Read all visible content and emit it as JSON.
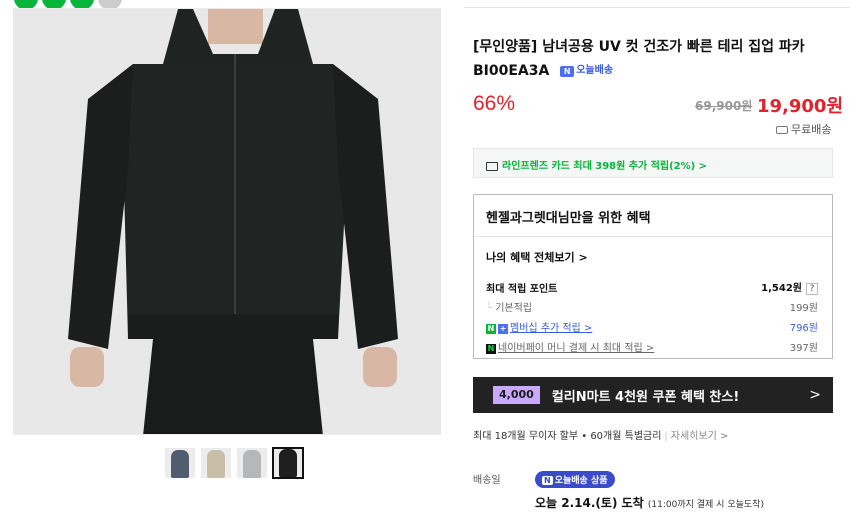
{
  "colors": {
    "accent_red": "#e0232e",
    "naver_green": "#07b53b",
    "today_blue": "#3b4cca",
    "banner_bg": "#222222",
    "coupon_purple": "#c9a8ff"
  },
  "product": {
    "title": "[무인양품] 남녀공용 UV 컷 건조가 빠른 테리 집업 파카 BI00EA3A",
    "today_badge": "오늘배송",
    "discount": "66%",
    "original_price": "69,900원",
    "sale_price": "19,900원",
    "shipping": "무료배송"
  },
  "card_promo": "라인프렌즈 카드 최대 398원 추가 적립(2%) >",
  "benefits": {
    "heading": "헨젤과그렛대님만을 위한 혜택",
    "view_all": "나의 혜택 전체보기 >",
    "max_points_label": "최대 적립 포인트",
    "max_points_value": "1,542원",
    "help": "?",
    "rows": [
      {
        "label": "기본적립",
        "value": "199원"
      },
      {
        "label": "멤버십 추가 적립 >",
        "value": "796원"
      },
      {
        "label": "네이버페이 머니 결제 시 최대 적립 >",
        "value": "397원"
      }
    ]
  },
  "banner": {
    "coupon": "4,000",
    "text": "컬리N마트 4천원 쿠폰 혜택 찬스!",
    "arrow": ">"
  },
  "installment": {
    "text": "최대 18개월 무이자 할부 • 60개월 특별금리",
    "detail": "자세히보기 >"
  },
  "delivery": {
    "label": "배송일",
    "tag": "오늘배송 상품",
    "date": "오늘 2.14.(토) 도착",
    "note": "(11:00까지 결제 시 오늘도착)"
  },
  "thumbnails": [
    {
      "name": "thumb-navy",
      "color": "#4f5d6e"
    },
    {
      "name": "thumb-beige",
      "color": "#c9bfa9"
    },
    {
      "name": "thumb-grey",
      "color": "#b5b7b9"
    },
    {
      "name": "thumb-black",
      "color": "#1c1f1d"
    }
  ]
}
